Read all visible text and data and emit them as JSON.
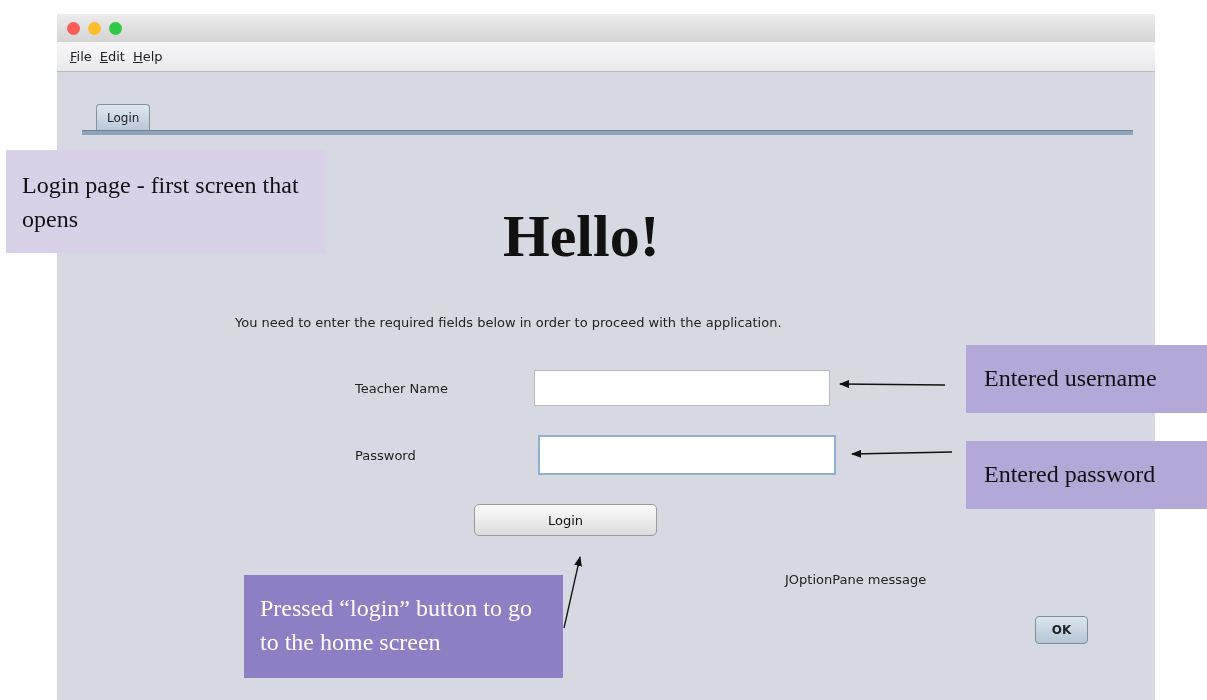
{
  "menu": [
    "File",
    "Edit",
    "Help"
  ],
  "tabs": [
    {
      "label": "Login",
      "selected": true
    }
  ],
  "heading": "Hello!",
  "instruction": "You need to enter the required fields below in order to proceed with the application.",
  "fields": [
    {
      "label": "Teacher Name",
      "focused": false
    },
    {
      "label": "Password",
      "focused": true
    }
  ],
  "login_button": "Login",
  "message": "JOptionPane message",
  "ok_button": "OK",
  "annotations": [
    {
      "text": "Login page - first screen that opens",
      "kind": "light"
    },
    {
      "text": "Entered username",
      "kind": "medium"
    },
    {
      "text": "Entered password",
      "kind": "medium"
    },
    {
      "text": "Pressed “login” button to go to the home screen",
      "kind": "dark"
    }
  ]
}
